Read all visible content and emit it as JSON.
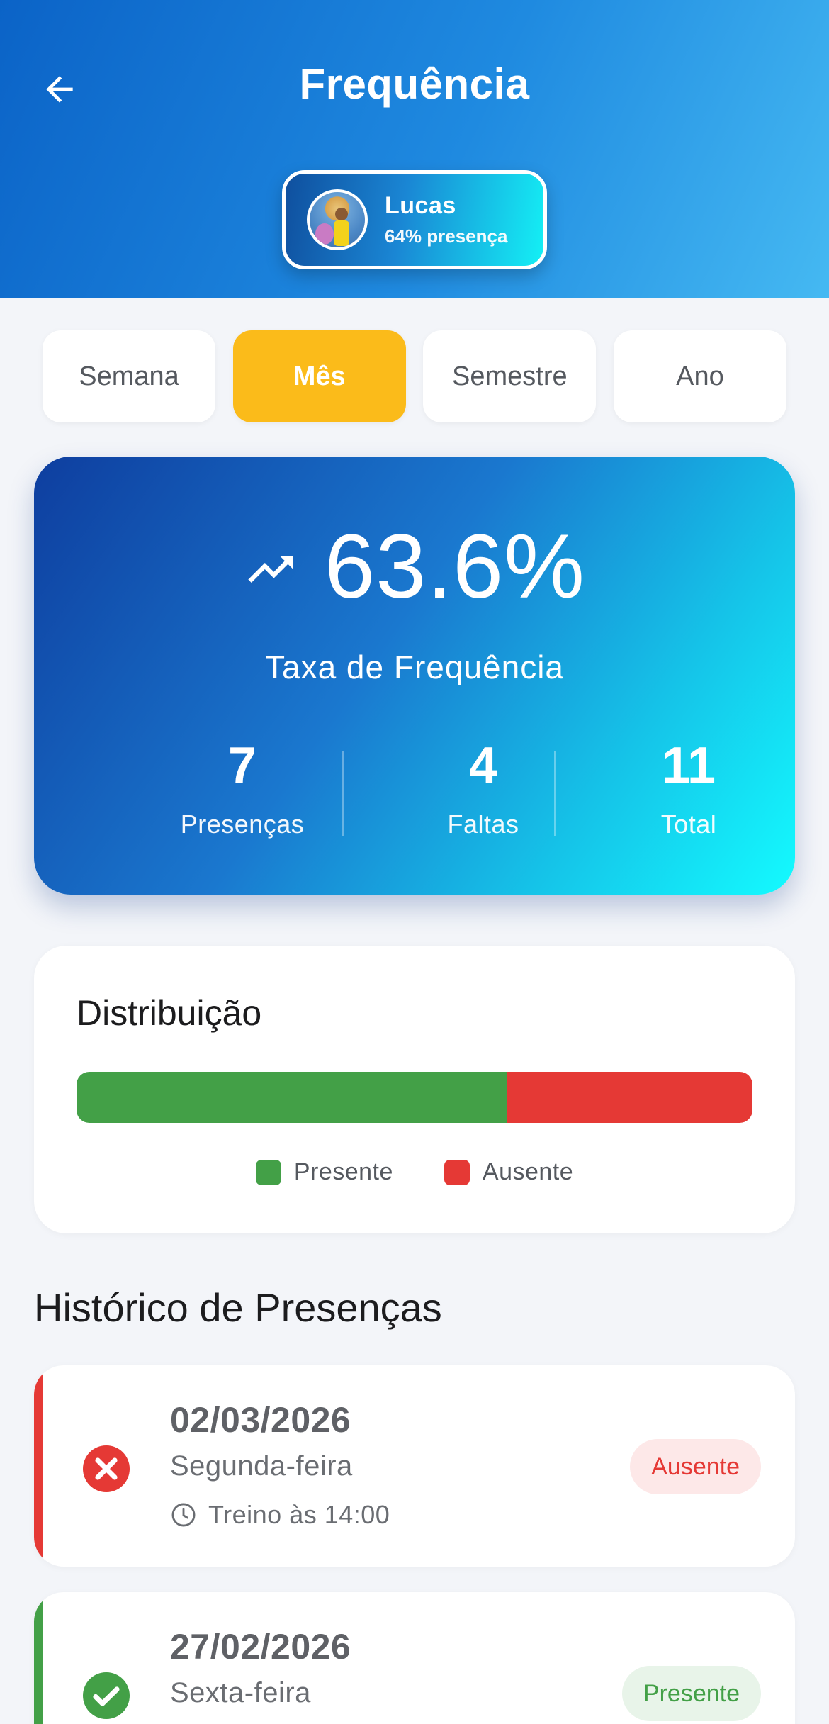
{
  "header": {
    "title": "Frequência",
    "back_icon": "arrow-left-icon",
    "student": {
      "name": "Lucas",
      "attendance_text": "64% presença"
    }
  },
  "tabs": [
    {
      "label": "Semana",
      "active": false
    },
    {
      "label": "Mês",
      "active": true
    },
    {
      "label": "Semestre",
      "active": false
    },
    {
      "label": "Ano",
      "active": false
    }
  ],
  "summary": {
    "rate": "63.6%",
    "rate_label": "Taxa de Frequência",
    "trend_icon": "trending-up-icon",
    "stats": [
      {
        "value": "7",
        "label": "Presenças"
      },
      {
        "value": "4",
        "label": "Faltas"
      },
      {
        "value": "11",
        "label": "Total"
      }
    ]
  },
  "distribution": {
    "title": "Distribuição",
    "present_fraction": 0.636,
    "legend": [
      {
        "label": "Presente",
        "color": "#43a047"
      },
      {
        "label": "Ausente",
        "color": "#e53935"
      }
    ]
  },
  "history": {
    "title": "Histórico de Presenças",
    "records": [
      {
        "date": "02/03/2026",
        "weekday": "Segunda-feira",
        "time": "Treino às 14:00",
        "status": "Ausente",
        "status_icon": "x-circle-icon",
        "color": "#e53935",
        "badge_bg": "#fde8e8"
      },
      {
        "date": "27/02/2026",
        "weekday": "Sexta-feira",
        "time": "",
        "status": "Presente",
        "status_icon": "check-circle-icon",
        "color": "#43a047",
        "badge_bg": "#e8f4e9"
      }
    ]
  },
  "colors": {
    "accent": "#fbbb1a",
    "present": "#43a047",
    "absent": "#e53935"
  }
}
